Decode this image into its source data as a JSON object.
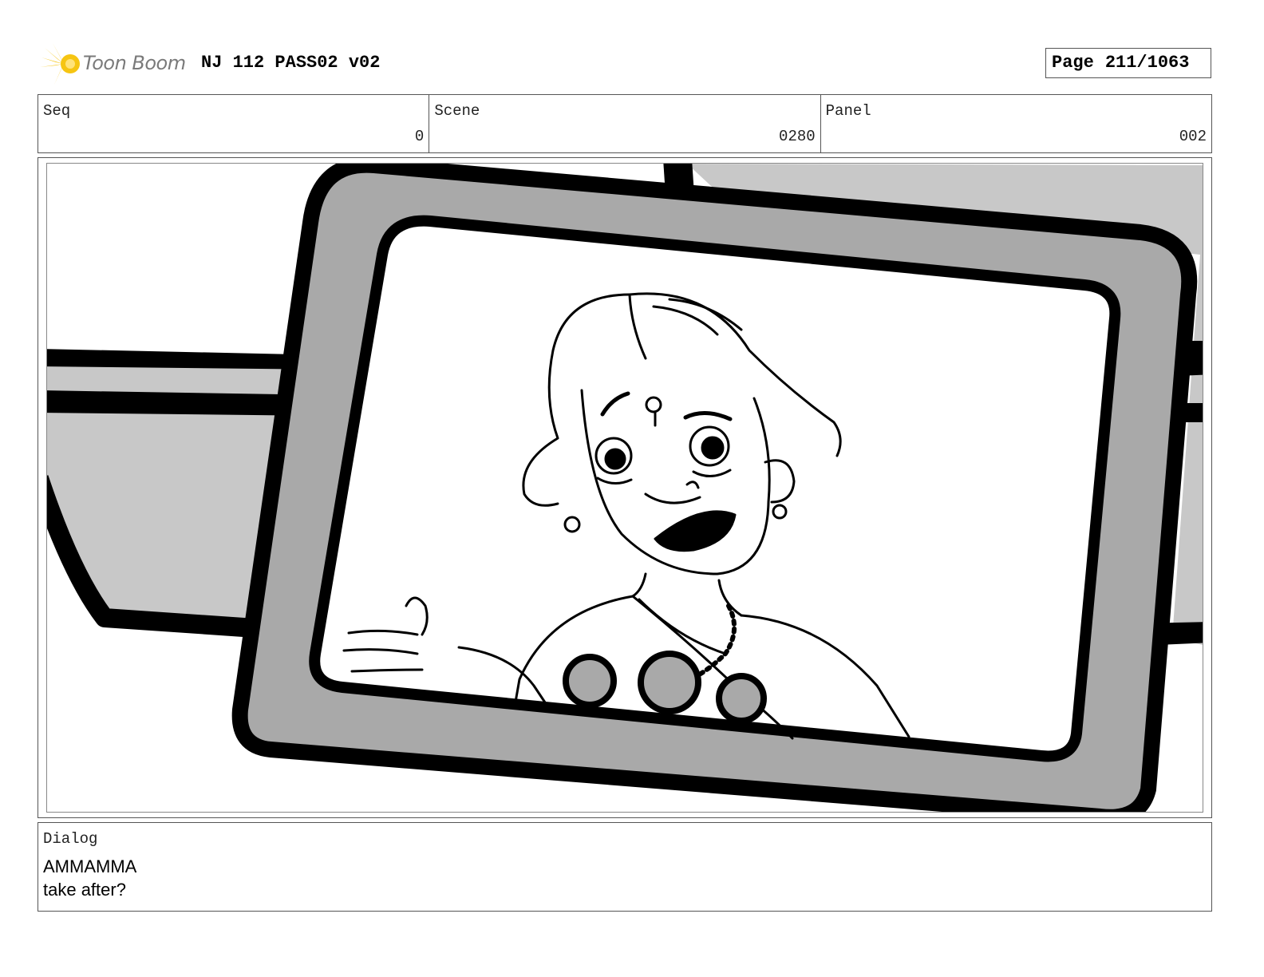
{
  "header": {
    "logo_text": "Toon Boom",
    "doc_title": "NJ 112 PASS02 v02",
    "page_label": "Page",
    "page_number": "211/1063"
  },
  "info": {
    "seq_label": "Seq",
    "seq_value": "0",
    "scene_label": "Scene",
    "scene_value": "0280",
    "panel_label": "Panel",
    "panel_value": "002"
  },
  "dialog": {
    "label": "Dialog",
    "speaker": "AMMAMMA",
    "line": "take after?"
  },
  "colors": {
    "ink": "#000000",
    "tone_light": "#c8c8c8",
    "tone_mid": "#a8a8a8",
    "logo_yellow": "#f6c512",
    "logo_text": "#7a7a7a"
  }
}
